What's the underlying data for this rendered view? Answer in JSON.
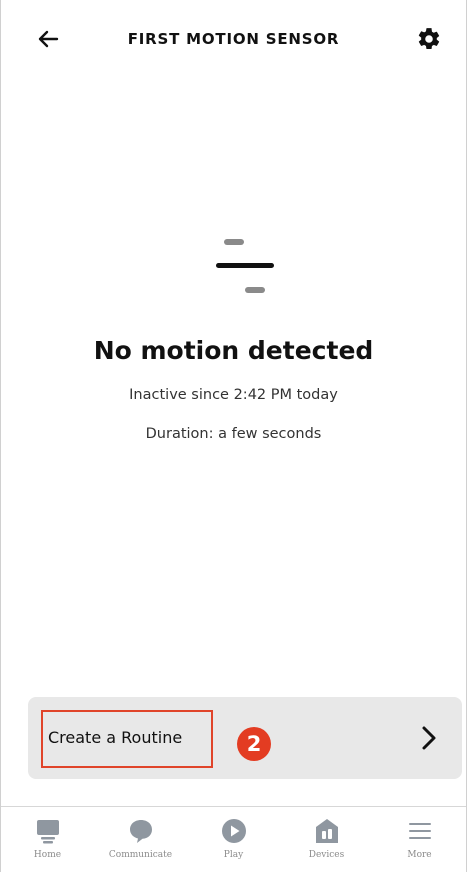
{
  "header": {
    "title": "FIRST MOTION SENSOR",
    "back_icon": "arrow-left-icon",
    "settings_icon": "gear-icon"
  },
  "status": {
    "title": "No motion detected",
    "inactive_since": "Inactive since 2:42 PM today",
    "duration": "Duration: a few seconds"
  },
  "routine": {
    "label": "Create a Routine",
    "step_badge": "2",
    "highlight_color": "#e0442a",
    "badge_color": "#e33c22"
  },
  "nav": {
    "items": [
      {
        "label": "Home",
        "icon": "home-icon"
      },
      {
        "label": "Communicate",
        "icon": "chat-bubble-icon"
      },
      {
        "label": "Play",
        "icon": "play-icon"
      },
      {
        "label": "Devices",
        "icon": "devices-house-icon"
      },
      {
        "label": "More",
        "icon": "menu-lines-icon"
      }
    ]
  }
}
